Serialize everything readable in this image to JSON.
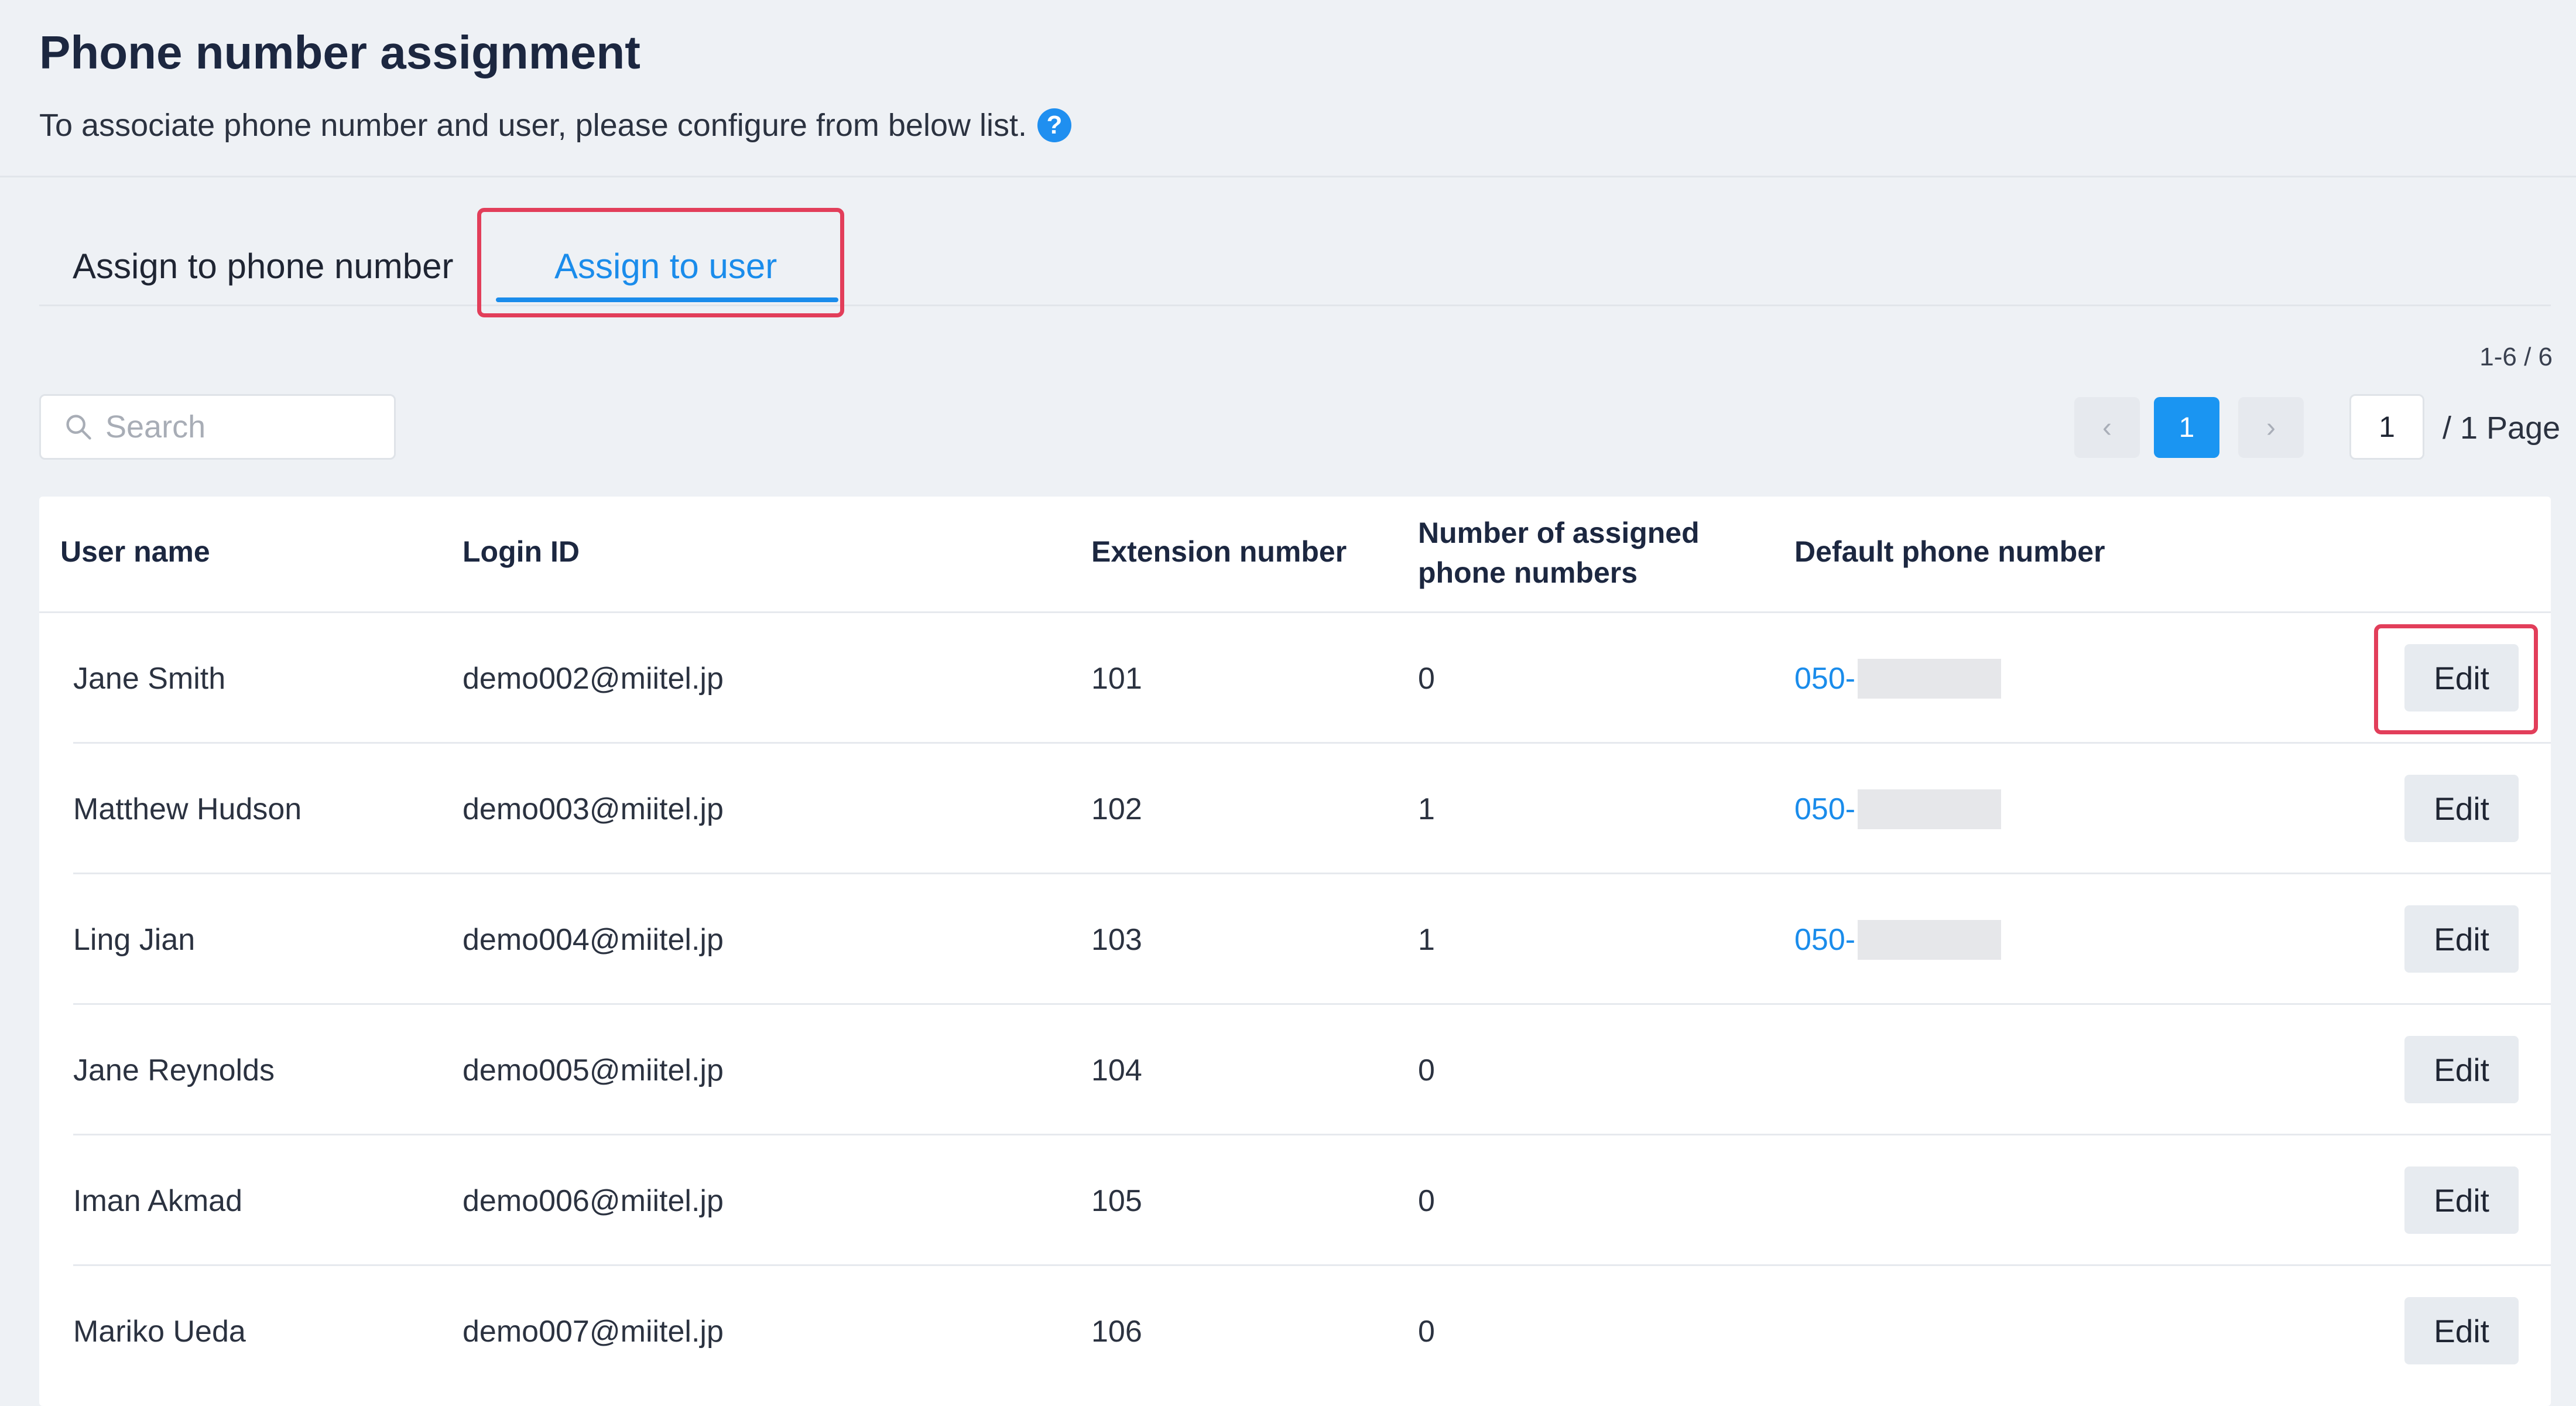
{
  "header": {
    "title": "Phone number assignment",
    "subtitle": "To associate phone number and user, please configure from below list.",
    "help_icon": "?"
  },
  "tabs": [
    {
      "label": "Assign to phone number",
      "active": false
    },
    {
      "label": "Assign to user",
      "active": true
    }
  ],
  "pagination": {
    "range": "1-6 / 6",
    "prev": "‹",
    "current": "1",
    "next": "›",
    "page_input": "1",
    "total": "/ 1 Page"
  },
  "search": {
    "placeholder": "Search"
  },
  "table": {
    "columns": [
      "User name",
      "Login ID",
      "Extension number",
      "Number of assigned phone numbers",
      "Default phone number"
    ],
    "edit_label": "Edit",
    "rows": [
      {
        "name": "Jane Smith",
        "login": "demo002@miitel.jp",
        "ext": "101",
        "count": "0",
        "phone": "050-"
      },
      {
        "name": "Matthew Hudson",
        "login": "demo003@miitel.jp",
        "ext": "102",
        "count": "1",
        "phone": "050-"
      },
      {
        "name": "Ling Jian",
        "login": "demo004@miitel.jp",
        "ext": "103",
        "count": "1",
        "phone": "050-"
      },
      {
        "name": "Jane Reynolds",
        "login": "demo005@miitel.jp",
        "ext": "104",
        "count": "0",
        "phone": ""
      },
      {
        "name": "Iman Akmad",
        "login": "demo006@miitel.jp",
        "ext": "105",
        "count": "0",
        "phone": ""
      },
      {
        "name": "Mariko Ueda",
        "login": "demo007@miitel.jp",
        "ext": "106",
        "count": "0",
        "phone": ""
      }
    ]
  },
  "colors": {
    "accent": "#1a8ceb",
    "highlight": "#e23e5a",
    "page_bg": "#eef1f5"
  }
}
